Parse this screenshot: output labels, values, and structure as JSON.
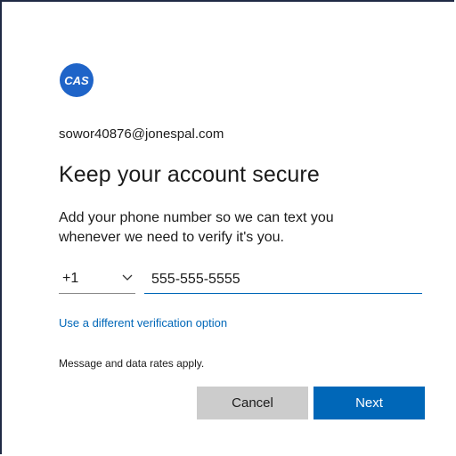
{
  "brand": {
    "logo_text": "CAS",
    "color": "#1f64c8"
  },
  "account": {
    "email": "sowor40876@jonespal.com"
  },
  "heading": "Keep your account secure",
  "description": "Add your phone number so we can text you whenever we need to verify it's you.",
  "phone": {
    "country_code": "+1",
    "number": "555-555-5555"
  },
  "alt_link": "Use a different verification option",
  "disclaimer": "Message and data rates apply.",
  "buttons": {
    "cancel": "Cancel",
    "next": "Next"
  },
  "colors": {
    "accent": "#0067b8",
    "cancel_bg": "#cccccc"
  }
}
